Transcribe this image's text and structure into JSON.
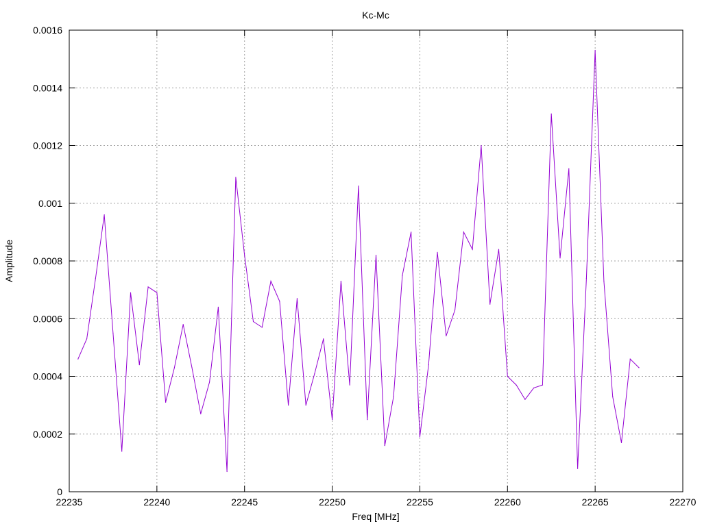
{
  "chart_data": {
    "type": "line",
    "title": "Kc-Mc",
    "xlabel": "Freq [MHz]",
    "ylabel": "Amplitude",
    "xlim": [
      22235,
      22270
    ],
    "ylim": [
      0,
      0.0016
    ],
    "x_ticks": [
      22235,
      22240,
      22245,
      22250,
      22255,
      22260,
      22265,
      22270
    ],
    "x_tick_labels": [
      "22235",
      "22240",
      "22245",
      "22250",
      "22255",
      "22260",
      "22265",
      "22270"
    ],
    "y_ticks": [
      0,
      0.0002,
      0.0004,
      0.0006,
      0.0008,
      0.001,
      0.0012,
      0.0014,
      0.0016
    ],
    "y_tick_labels": [
      "0",
      "0.0002",
      "0.0004",
      "0.0006",
      "0.0008",
      "0.001",
      "0.0012",
      "0.0014",
      "0.0016"
    ],
    "grid": true,
    "series": [
      {
        "color": "#9400d3",
        "x": [
          22235.5,
          22236,
          22236.5,
          22237,
          22237.5,
          22238,
          22238.5,
          22239,
          22239.5,
          22240,
          22240.5,
          22241,
          22241.5,
          22242,
          22242.5,
          22243,
          22243.5,
          22244,
          22244.5,
          22245,
          22245.5,
          22246,
          22246.5,
          22247,
          22247.5,
          22248,
          22248.5,
          22249,
          22249.5,
          22250,
          22250.5,
          22251,
          22251.5,
          22252,
          22252.5,
          22253,
          22253.5,
          22254,
          22254.5,
          22255,
          22255.5,
          22256,
          22256.5,
          22257,
          22257.5,
          22258,
          22258.5,
          22259,
          22259.5,
          22260,
          22260.5,
          22261,
          22261.5,
          22262,
          22262.5,
          22263,
          22263.5,
          22264,
          22264.5,
          22265,
          22265.5,
          22266,
          22266.5,
          22267,
          22267.5
        ],
        "y": [
          0.00046,
          0.00053,
          0.00074,
          0.00096,
          0.00055,
          0.00014,
          0.00069,
          0.00044,
          0.00071,
          0.00069,
          0.00031,
          0.00043,
          0.00058,
          0.00043,
          0.00027,
          0.00038,
          0.00064,
          7e-05,
          0.00109,
          0.00082,
          0.00059,
          0.00057,
          0.00073,
          0.00066,
          0.0003,
          0.00067,
          0.0003,
          0.00041,
          0.00053,
          0.00025,
          0.00073,
          0.00037,
          0.00106,
          0.00025,
          0.00082,
          0.00016,
          0.00033,
          0.00075,
          0.0009,
          0.00019,
          0.00044,
          0.00083,
          0.00054,
          0.00063,
          0.0009,
          0.00084,
          0.0012,
          0.00065,
          0.00084,
          0.0004,
          0.00037,
          0.00032,
          0.00036,
          0.00037,
          0.00131,
          0.00081,
          0.00112,
          8e-05,
          0.00074,
          0.00153,
          0.00073,
          0.00033,
          0.00017,
          0.00046,
          0.00043
        ]
      }
    ]
  }
}
